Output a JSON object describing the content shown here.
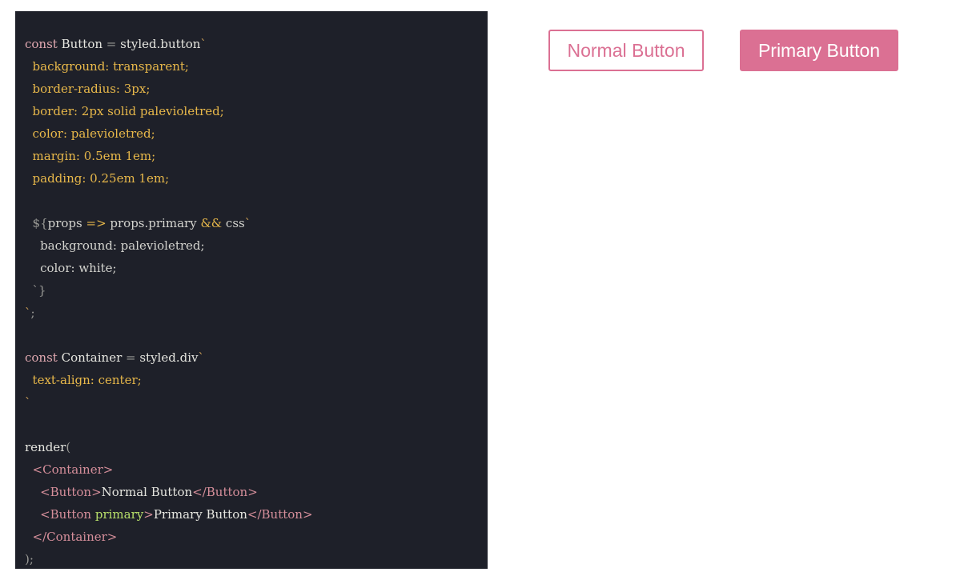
{
  "code_editor": {
    "lines": [
      [
        [
          "kw",
          "const "
        ],
        [
          "id",
          "Button "
        ],
        [
          "pun",
          "= "
        ],
        [
          "id",
          "styled.button"
        ],
        [
          "tpl",
          "`"
        ]
      ],
      [
        [
          "prop",
          "  background: transparent;"
        ]
      ],
      [
        [
          "prop",
          "  border-radius: 3px;"
        ]
      ],
      [
        [
          "prop",
          "  border: 2px solid palevioletred;"
        ]
      ],
      [
        [
          "prop",
          "  color: palevioletred;"
        ]
      ],
      [
        [
          "prop",
          "  margin: 0.5em 1em;"
        ]
      ],
      [
        [
          "prop",
          "  padding: 0.25em 1em;"
        ]
      ],
      [],
      [
        [
          "pun",
          "  ${"
        ],
        [
          "ip",
          "props "
        ],
        [
          "op",
          "=> "
        ],
        [
          "ip",
          "props.primary "
        ],
        [
          "op",
          "&& "
        ],
        [
          "ip",
          "css"
        ],
        [
          "tpl",
          "`"
        ]
      ],
      [
        [
          "ip",
          "    background: palevioletred;"
        ]
      ],
      [
        [
          "ip",
          "    color: white;"
        ]
      ],
      [
        [
          "pun",
          "  `}"
        ]
      ],
      [
        [
          "tpl",
          "`"
        ],
        [
          "pun",
          ";"
        ]
      ],
      [],
      [
        [
          "kw",
          "const "
        ],
        [
          "id",
          "Container "
        ],
        [
          "pun",
          "= "
        ],
        [
          "id",
          "styled.div"
        ],
        [
          "tpl",
          "`"
        ]
      ],
      [
        [
          "prop",
          "  text-align: center;"
        ]
      ],
      [
        [
          "tpl",
          "`"
        ]
      ],
      [],
      [
        [
          "id",
          "render"
        ],
        [
          "pun",
          "("
        ]
      ],
      [
        [
          "tag",
          "  <Container>"
        ]
      ],
      [
        [
          "tag",
          "    <Button>"
        ],
        [
          "id",
          "Normal Button"
        ],
        [
          "tag",
          "</Button>"
        ]
      ],
      [
        [
          "tag",
          "    <Button "
        ],
        [
          "attr",
          "primary"
        ],
        [
          "tag",
          ">"
        ],
        [
          "id",
          "Primary Button"
        ],
        [
          "tag",
          "</Button>"
        ]
      ],
      [
        [
          "tag",
          "  </Container>"
        ]
      ],
      [
        [
          "pun",
          ");"
        ]
      ]
    ]
  },
  "preview": {
    "normal_button_label": "Normal Button",
    "primary_button_label": "Primary Button"
  },
  "colors": {
    "accent": "#db7093",
    "editor_bg": "#1e2029"
  }
}
